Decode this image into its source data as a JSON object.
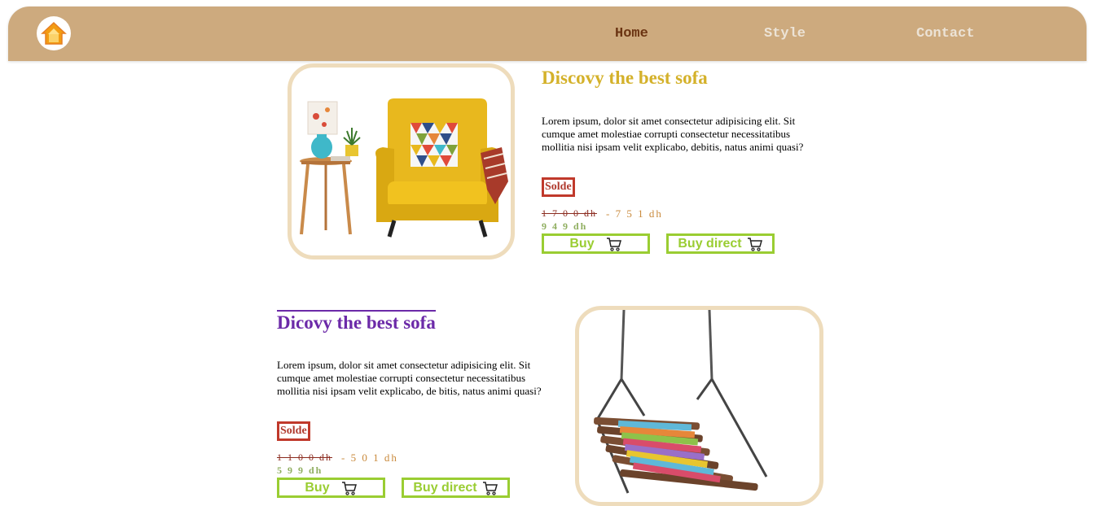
{
  "nav": {
    "logo_icon": "home-icon",
    "links": [
      "Home",
      "Style",
      "Contact"
    ],
    "active": "Home"
  },
  "colors": {
    "navbar": "#cdaa7e",
    "active_link": "#6b3412",
    "inactive_link": "#ece3d6",
    "title1": "#d4b12a",
    "title2": "#6c2aa8",
    "badge": "#c0392b",
    "button": "#9acd32",
    "frame": "#eedcbc"
  },
  "products": [
    {
      "title": "Discovy the best sofa",
      "description": "Lorem ipsum, dolor sit amet consectetur adipisicing elit. Sit cumque amet molestiae corrupti consectetur necessitatibus mollitia nisi ipsam velit explicabo, debitis, natus animi quasi?",
      "badge": "Solde",
      "old_price": "1 7 0 0 dh",
      "discount": "- 7 5 1 dh",
      "new_price": "9 4 9 dh",
      "buy_label": "Buy",
      "buy_direct_label": "Buy direct",
      "image_icon": "yellow-armchair-image"
    },
    {
      "title": "Dicovy the best sofa",
      "description": "Lorem ipsum, dolor sit amet consectetur adipisicing elit. Sit cumque amet molestiae corrupti consectetur necessitatibus mollitia nisi ipsam velit explicabo, de bitis, natus animi quasi?",
      "badge": "Solde",
      "old_price": "1 1 0 0 dh",
      "discount": "- 5 0 1 dh",
      "new_price": "5 9 9 dh",
      "buy_label": "Buy",
      "buy_direct_label": "Buy direct",
      "image_icon": "hanging-swing-chair-image"
    }
  ]
}
